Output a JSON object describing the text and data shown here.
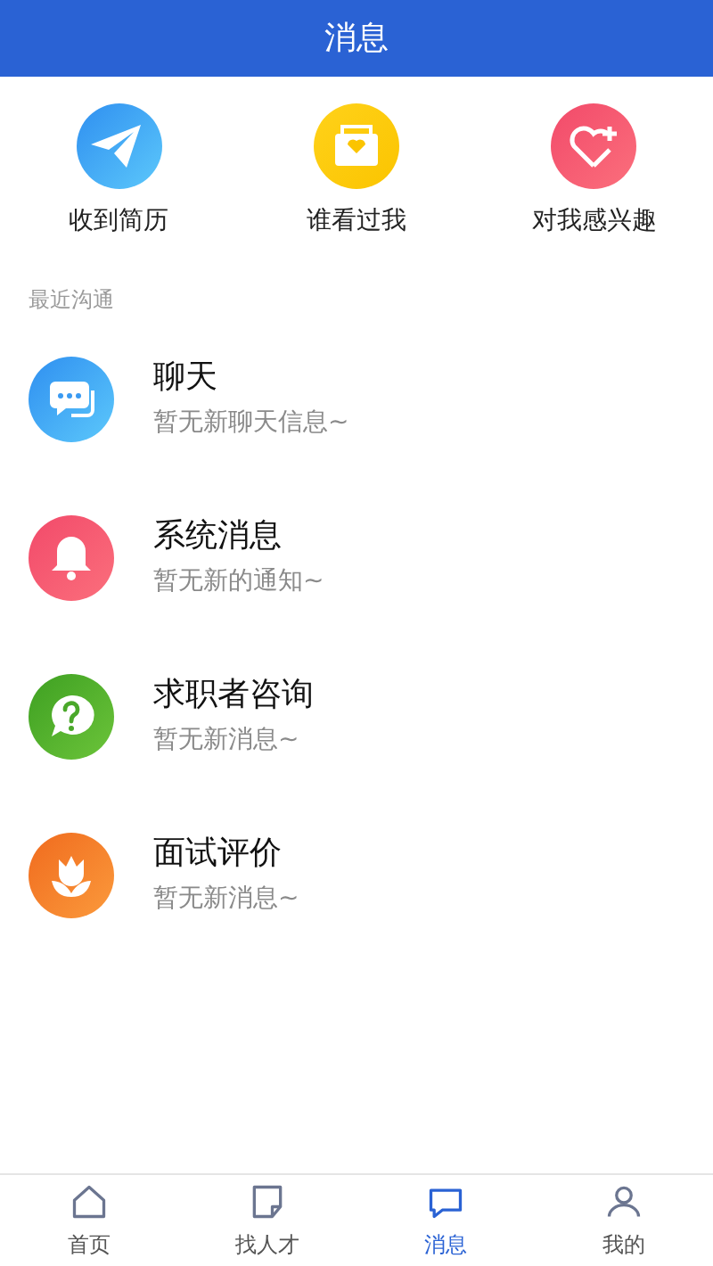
{
  "header": {
    "title": "消息"
  },
  "shortcuts": [
    {
      "kind": "plane",
      "label": "收到简历"
    },
    {
      "kind": "envelope",
      "label": "谁看过我"
    },
    {
      "kind": "heart",
      "label": "对我感兴趣"
    }
  ],
  "section_label": "最近沟通",
  "conversations": [
    {
      "kind": "chat",
      "title": "聊天",
      "subtitle": "暂无新聊天信息~"
    },
    {
      "kind": "bell",
      "title": "系统消息",
      "subtitle": "暂无新的通知~"
    },
    {
      "kind": "question",
      "title": "求职者咨询",
      "subtitle": "暂无新消息~"
    },
    {
      "kind": "flower",
      "title": "面试评价",
      "subtitle": "暂无新消息~"
    }
  ],
  "tab_bar": [
    {
      "kind": "home",
      "label": "首页",
      "selected": false
    },
    {
      "kind": "note",
      "label": "找人才",
      "selected": false
    },
    {
      "kind": "message",
      "label": "消息",
      "selected": true
    },
    {
      "kind": "person",
      "label": "我的",
      "selected": false
    }
  ]
}
